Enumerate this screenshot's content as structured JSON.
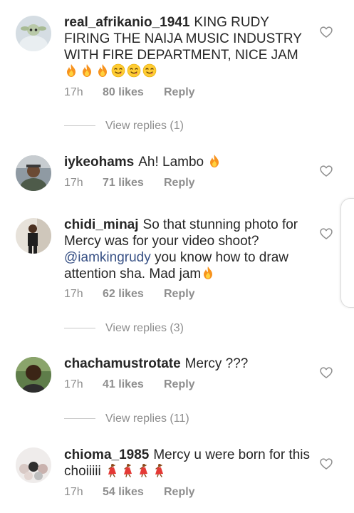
{
  "comments": [
    {
      "username": "real_afrikanio_1941",
      "text": "KING RUDY FIRING THE NAIJA MUSIC INDUSTRY WITH FIRE DEPARTMENT, NICE JAM",
      "emojis": [
        "fire",
        "fire",
        "fire",
        "yum",
        "yum",
        "yum"
      ],
      "time": "17h",
      "likes": "80 likes",
      "reply": "Reply",
      "view_replies": "View replies (1)"
    },
    {
      "username": "iykeohams",
      "text": "Ah! Lambo",
      "emojis": [
        "fire"
      ],
      "time": "17h",
      "likes": "71 likes",
      "reply": "Reply"
    },
    {
      "username": "chidi_minaj",
      "text_before": "So that stunning photo for Mercy was for your video shoot?",
      "mention": "@iamkingrudy",
      "text_after": "you know how to draw attention sha. Mad jam",
      "emojis": [
        "fire"
      ],
      "time": "17h",
      "likes": "62 likes",
      "reply": "Reply",
      "view_replies": "View replies (3)"
    },
    {
      "username": "chachamustrotate",
      "text": "Mercy ???",
      "time": "17h",
      "likes": "41 likes",
      "reply": "Reply",
      "view_replies": "View replies (11)"
    },
    {
      "username": "chioma_1985",
      "text": "Mercy u were born for this choiiiii",
      "emojis": [
        "dancer",
        "dancer",
        "dancer",
        "dancer"
      ],
      "time": "17h",
      "likes": "54 likes",
      "reply": "Reply"
    }
  ],
  "icons": {
    "like": "heart-outline-icon",
    "fire": "fire-emoji",
    "yum": "face-savoring-food-emoji",
    "dancer": "dancer-emoji"
  },
  "colors": {
    "text": "#262626",
    "meta": "#8e8e8e",
    "mention": "#385185"
  }
}
